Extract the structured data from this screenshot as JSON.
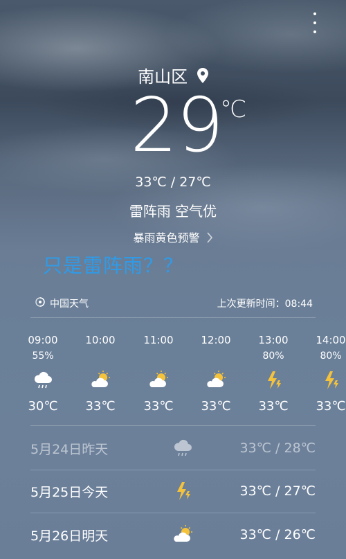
{
  "location": {
    "city": "南山区"
  },
  "current": {
    "temperature": "29",
    "unit": "℃",
    "range": "33℃ / 27℃",
    "condition": "雷阵雨  空气优",
    "alert": "暴雨黄色预警"
  },
  "caption": "只是雷阵雨？？",
  "source": {
    "label": "中国天气",
    "last_update": "上次更新时间：08:44"
  },
  "hourly": [
    {
      "time": "09:00",
      "precip": "55%",
      "icon": "cloud-rain-icon",
      "temp": "30℃"
    },
    {
      "time": "10:00",
      "precip": "",
      "icon": "partly-cloudy-icon",
      "temp": "33℃"
    },
    {
      "time": "11:00",
      "precip": "",
      "icon": "partly-cloudy-icon",
      "temp": "33℃"
    },
    {
      "time": "12:00",
      "precip": "",
      "icon": "partly-cloudy-icon",
      "temp": "33℃"
    },
    {
      "time": "13:00",
      "precip": "80%",
      "icon": "thunder-icon",
      "temp": "33℃"
    },
    {
      "time": "14:00",
      "precip": "80%",
      "icon": "thunder-icon",
      "temp": "33℃"
    }
  ],
  "daily": [
    {
      "date": "5月24日昨天",
      "icon": "cloud-rain-icon",
      "range": "33℃ / 28℃"
    },
    {
      "date": "5月25日今天",
      "icon": "thunder-icon",
      "range": "33℃ / 27℃"
    },
    {
      "date": "5月26日明天",
      "icon": "partly-cloudy-icon",
      "range": "33℃ / 26℃"
    }
  ],
  "colors": {
    "caption": "#2f9be8",
    "sun": "#f5c23b",
    "bolt": "#f5c23b"
  }
}
